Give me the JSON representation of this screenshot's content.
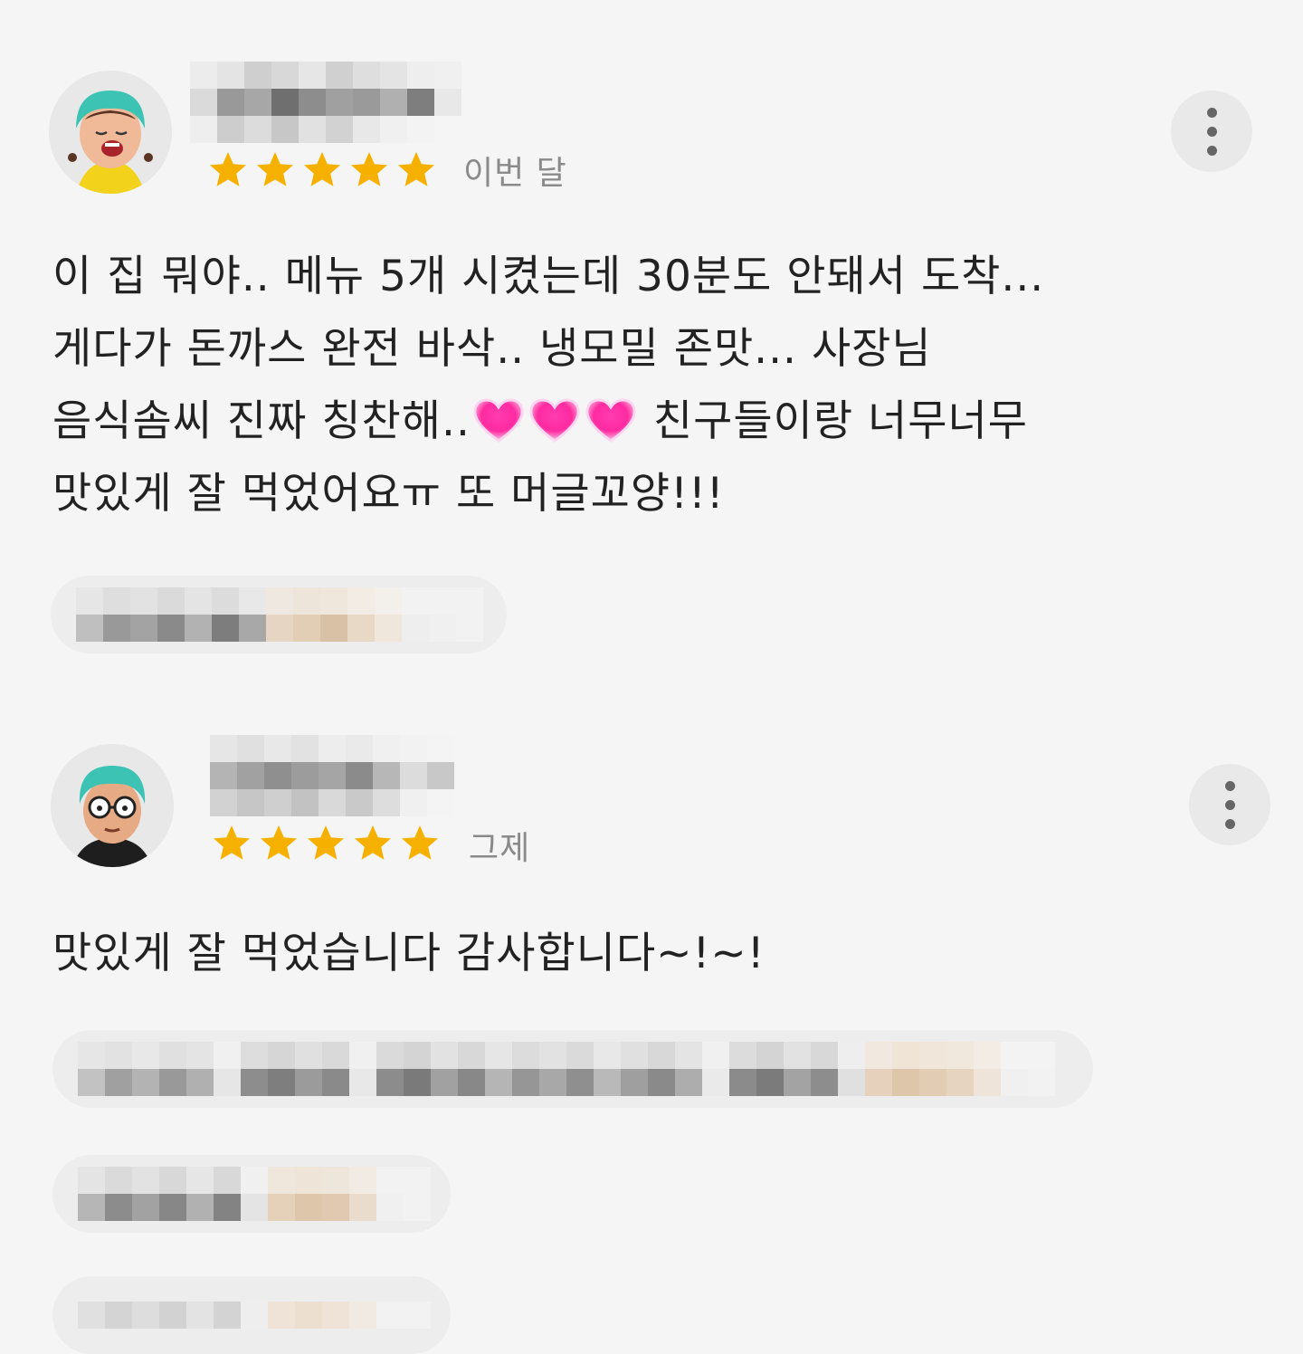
{
  "reviews": [
    {
      "avatar_icon": "girl-character-avatar-icon",
      "rating": 5,
      "date": "이번 달",
      "more_icon": "more-vertical-icon",
      "text_lines": [
        "이 집 뭐야.. 메뉴 5개 시켰는데 30분도 안돼서 도착...",
        "게다가 돈까스 완전 바삭.. 냉모밀 존맛... 사장님",
        "음식솜씨 진짜 칭찬해..",
        " 친구들이랑 너무너무",
        "맛있게 잘 먹었어요ㅠ 또 머글꼬양!!!"
      ],
      "emoji": "heart-icon"
    },
    {
      "avatar_icon": "glasses-character-avatar-icon",
      "rating": 5,
      "date": "그제",
      "more_icon": "more-vertical-icon",
      "text_lines": [
        "맛있게 잘 먹었습니다 감사합니다~!~!"
      ]
    }
  ],
  "colors": {
    "background": "#f5f5f5",
    "star": "#f6b100",
    "date_gray": "#8a8a8a",
    "heart_pink": "#ff2aa0"
  }
}
